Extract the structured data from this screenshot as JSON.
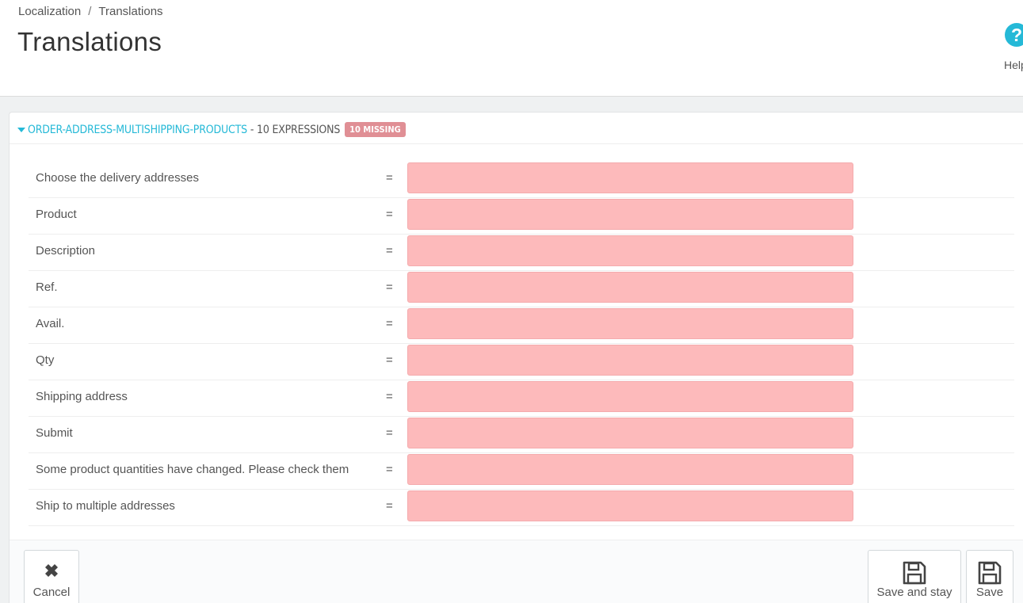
{
  "breadcrumb": {
    "parent": "Localization",
    "separator": "/",
    "current": "Translations"
  },
  "page_title": "Translations",
  "toolbar": {
    "help_label": "Help",
    "help_glyph": "?"
  },
  "section": {
    "category": "ORDER-ADDRESS-MULTISHIPPING-PRODUCTS",
    "count_text": "- 10 EXPRESSIONS",
    "missing_badge": "10 MISSING"
  },
  "rows": [
    {
      "label": "Choose the delivery addresses",
      "eq": "=",
      "value": ""
    },
    {
      "label": "Product",
      "eq": "=",
      "value": ""
    },
    {
      "label": "Description",
      "eq": "=",
      "value": ""
    },
    {
      "label": "Ref.",
      "eq": "=",
      "value": ""
    },
    {
      "label": "Avail.",
      "eq": "=",
      "value": ""
    },
    {
      "label": "Qty",
      "eq": "=",
      "value": ""
    },
    {
      "label": "Shipping address",
      "eq": "=",
      "value": ""
    },
    {
      "label": "Submit",
      "eq": "=",
      "value": ""
    },
    {
      "label": "Some product quantities have changed. Please check them",
      "eq": "=",
      "value": ""
    },
    {
      "label": "Ship to multiple addresses",
      "eq": "=",
      "value": ""
    }
  ],
  "footer": {
    "cancel_label": "Cancel",
    "save_and_stay_label": "Save and stay",
    "save_label": "Save"
  },
  "icons": {
    "help": "help-icon",
    "cancel": "close-icon",
    "save_and_stay": "floppy-disk-icon",
    "save": "floppy-disk-icon"
  },
  "colors": {
    "accent": "#25b9d7",
    "missing_badge": "#e08f95",
    "missing_input": "#fdbabb"
  }
}
